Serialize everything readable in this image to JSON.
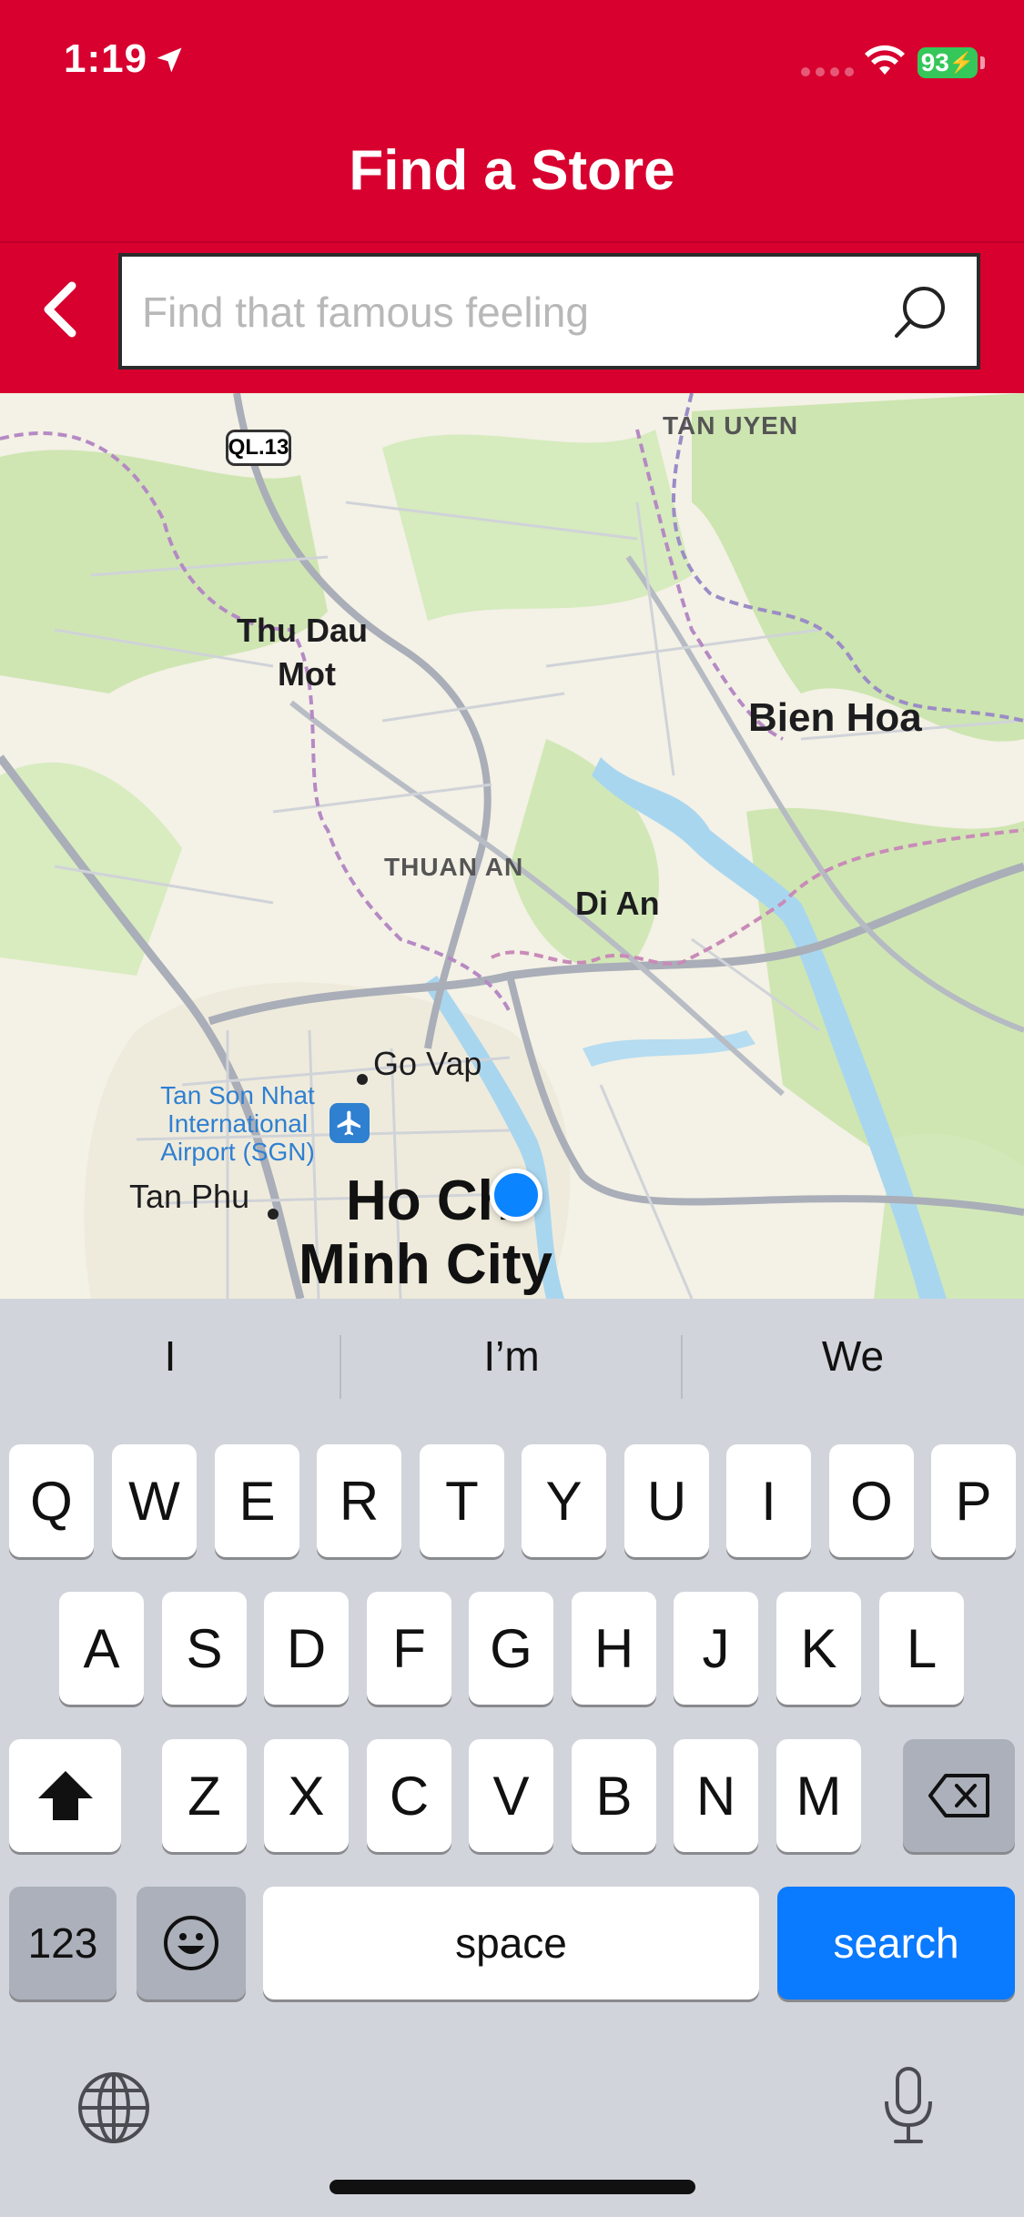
{
  "status_bar": {
    "time": "1:19",
    "battery": "93"
  },
  "header": {
    "title": "Find a Store",
    "search": {
      "placeholder": "Find that famous feeling",
      "value": ""
    }
  },
  "map": {
    "road_shield": "QL.13",
    "labels": {
      "tan_uyen": "TAN UYEN",
      "thu_dau_mot_1": "Thu Dau",
      "thu_dau_mot_2": "Mot",
      "bien_hoa": "Bien Hoa",
      "thuan_an": "THUAN AN",
      "di_an": "Di An",
      "go_vap": "Go Vap",
      "airport_1": "Tan Son Nhat",
      "airport_2": "International",
      "airport_3": "Airport (SGN)",
      "tan_phu": "Tan Phu",
      "hcmc_1": "Ho Chi",
      "hcmc_2": "Minh City"
    }
  },
  "keyboard": {
    "suggestions": [
      "I",
      "I’m",
      "We"
    ],
    "row1": [
      "Q",
      "W",
      "E",
      "R",
      "T",
      "Y",
      "U",
      "I",
      "O",
      "P"
    ],
    "row2": [
      "A",
      "S",
      "D",
      "F",
      "G",
      "H",
      "J",
      "K",
      "L"
    ],
    "row3": [
      "Z",
      "X",
      "C",
      "V",
      "B",
      "N",
      "M"
    ],
    "numbers_label": "123",
    "space_label": "space",
    "search_label": "search"
  }
}
